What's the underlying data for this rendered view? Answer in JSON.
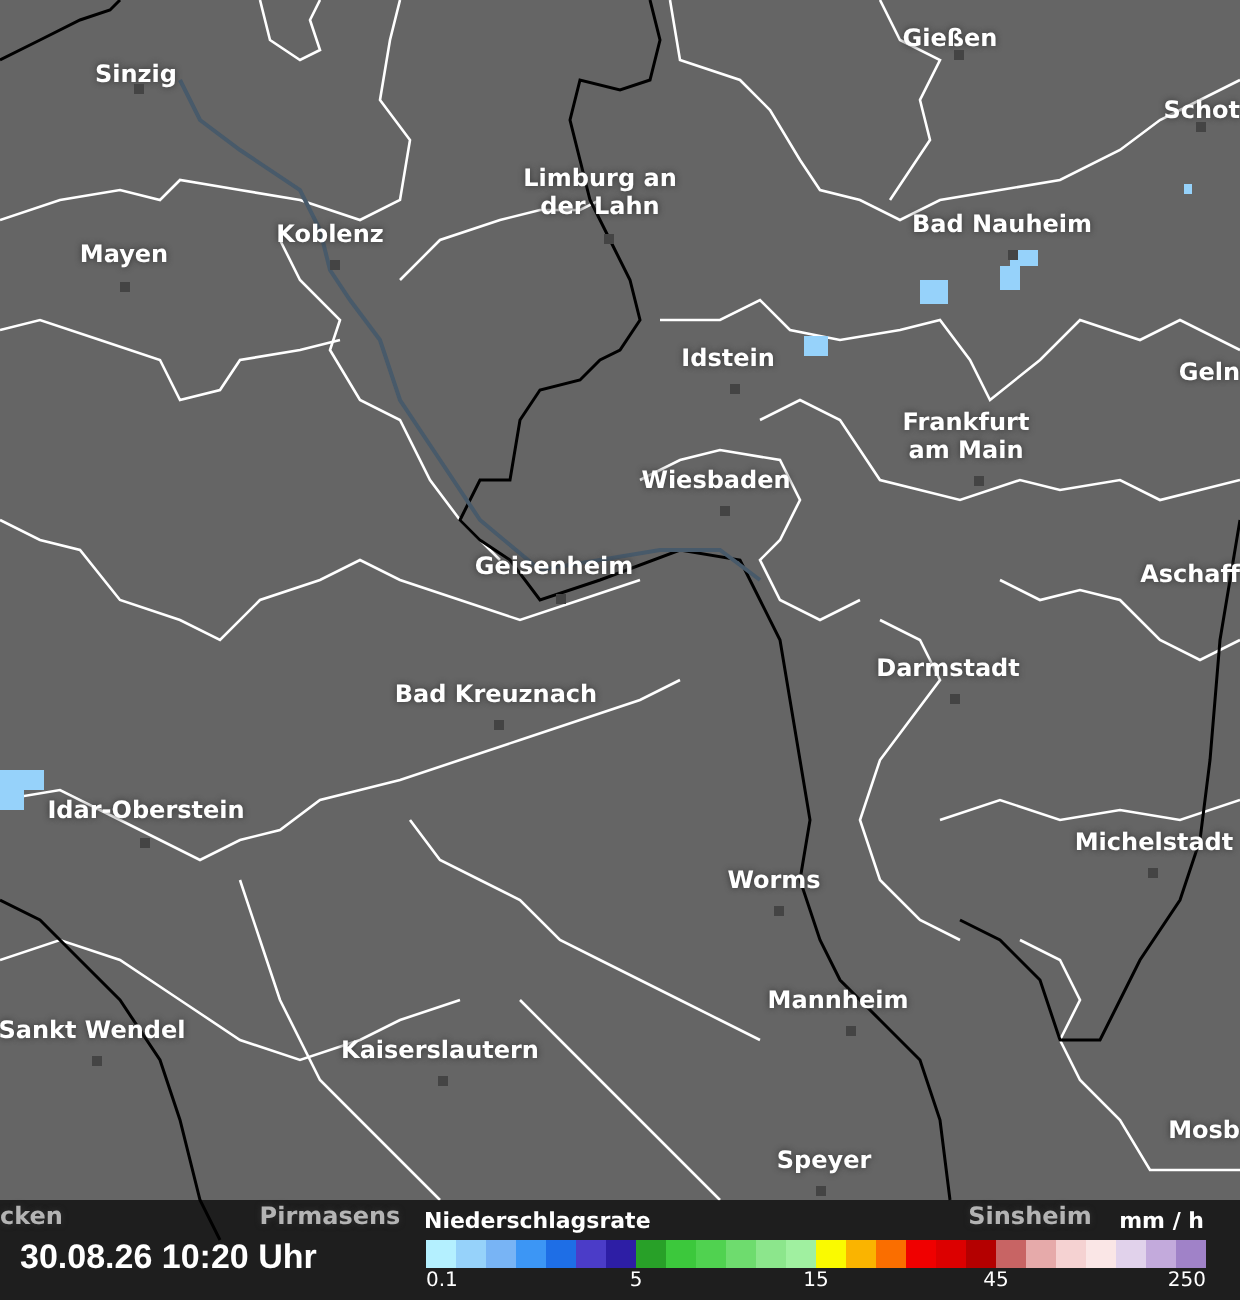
{
  "map": {
    "cities": [
      {
        "label": [
          "Gießen"
        ],
        "marker": true
      },
      {
        "label": [
          "Sinzig"
        ],
        "marker": true
      },
      {
        "label": [
          "Schot"
        ],
        "marker": true
      },
      {
        "label": [
          "Limburg an",
          "der Lahn"
        ],
        "marker": true
      },
      {
        "label": [
          "Koblenz"
        ],
        "marker": true
      },
      {
        "label": [
          "Mayen"
        ],
        "marker": true
      },
      {
        "label": [
          "Bad Nauheim"
        ],
        "marker": true
      },
      {
        "label": [
          "Idstein"
        ],
        "marker": true
      },
      {
        "label": [
          "Geln"
        ],
        "marker": false
      },
      {
        "label": [
          "Frankfurt",
          "am Main"
        ],
        "marker": true
      },
      {
        "label": [
          "Wiesbaden"
        ],
        "marker": true
      },
      {
        "label": [
          "Geisenheim"
        ],
        "marker": true
      },
      {
        "label": [
          "Aschaff"
        ],
        "marker": false
      },
      {
        "label": [
          "Darmstadt"
        ],
        "marker": true
      },
      {
        "label": [
          "Bad Kreuznach"
        ],
        "marker": true
      },
      {
        "label": [
          "Idar-Oberstein"
        ],
        "marker": true
      },
      {
        "label": [
          "Michelstadt"
        ],
        "marker": true
      },
      {
        "label": [
          "Worms"
        ],
        "marker": true
      },
      {
        "label": [
          "Mannheim"
        ],
        "marker": true
      },
      {
        "label": [
          "Sankt Wendel"
        ],
        "marker": true
      },
      {
        "label": [
          "Kaiserslautern"
        ],
        "marker": true
      },
      {
        "label": [
          "Mosb"
        ],
        "marker": false
      },
      {
        "label": [
          "Speyer"
        ],
        "marker": true
      },
      {
        "label": [
          "cken"
        ],
        "marker": false
      },
      {
        "label": [
          "Pirmasens"
        ],
        "marker": false
      },
      {
        "label": [
          "Sinsheim"
        ],
        "marker": false
      }
    ]
  },
  "timestamp": "30.08.26 10:20 Uhr",
  "legend": {
    "title": "Niederschlagsrate",
    "unit": "mm / h",
    "swatches": [
      {
        "color": "#b4f0ff"
      },
      {
        "color": "#96d2fa"
      },
      {
        "color": "#78b4f5"
      },
      {
        "color": "#3c96f5"
      },
      {
        "color": "#1e6ee6"
      },
      {
        "color": "#4b3cc8"
      },
      {
        "color": "#2d1ea5"
      },
      {
        "color": "#28a028"
      },
      {
        "color": "#3cc83c"
      },
      {
        "color": "#50d250"
      },
      {
        "color": "#6edc6e"
      },
      {
        "color": "#8ce68c"
      },
      {
        "color": "#a0f0a0"
      },
      {
        "color": "#fafa00"
      },
      {
        "color": "#fab400"
      },
      {
        "color": "#fa6e00"
      },
      {
        "color": "#f00000"
      },
      {
        "color": "#dc0000"
      },
      {
        "color": "#b40000"
      },
      {
        "color": "#c86464"
      },
      {
        "color": "#e6aaaa"
      },
      {
        "color": "#f5d2d2"
      },
      {
        "color": "#fae6e6"
      },
      {
        "color": "#e1d2eb"
      },
      {
        "color": "#c3aadc"
      },
      {
        "color": "#a082c8"
      }
    ],
    "ticks": [
      "0.1",
      "5",
      "15",
      "45",
      "250"
    ]
  }
}
